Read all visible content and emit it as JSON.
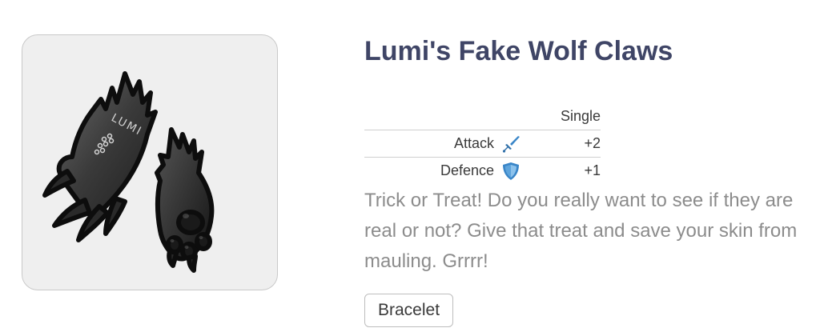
{
  "item": {
    "name": "Lumi's Fake Wolf Claws",
    "image_icon": "wolf-claws-icon",
    "image_text": "LUMI"
  },
  "stats": {
    "column_header": "Single",
    "rows": [
      {
        "label": "Attack",
        "icon": "sword-icon",
        "value": "+2"
      },
      {
        "label": "Defence",
        "icon": "shield-icon",
        "value": "+1"
      }
    ]
  },
  "description": "Trick or Treat! Do you really want to see if they are real or not? Give that treat and save your skin from mauling. Grrrr!",
  "tag": {
    "label": "Bracelet"
  },
  "colors": {
    "title": "#3f4566",
    "description": "#8c8c8c",
    "icon_blue": "#3a86c8",
    "card_bg": "#efefef"
  }
}
